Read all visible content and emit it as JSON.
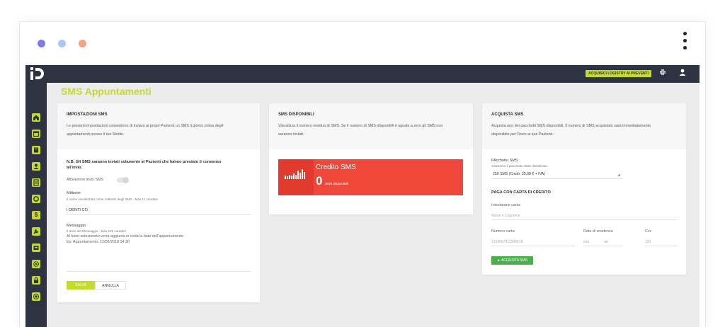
{
  "window": {
    "dot_colors": [
      "#7b7bea",
      "#a8c8f5",
      "#f2a585"
    ]
  },
  "colors": {
    "accent": "#c6da2a",
    "dark": "#2d3340",
    "danger": "#ef473a",
    "success": "#4cae4c"
  },
  "topbar": {
    "promo_label": "ACQUISICI LOGISTRY AI PREVENTI"
  },
  "sidebar": {
    "items": [
      "home-icon",
      "calendar-icon",
      "agenda-icon",
      "user-icon",
      "document-icon",
      "refresh-icon",
      "dollar-icon",
      "wrench-icon",
      "inbox-icon",
      "gear-icon",
      "lock-icon",
      "target-icon"
    ]
  },
  "page": {
    "title": "SMS Appuntamenti"
  },
  "settings": {
    "title": "IMPOSTAZIONI SMS",
    "desc1": "Le presenti impostazioni consentono di inviare ai propri Pazienti un SMS il giorno prima degli",
    "desc2": "appuntamenti presso il tuo Studio.",
    "note1": "N.B. Gli SMS saranno inviati solamente ai Pazienti che hanno prestato il consenso",
    "note2": "all'invio.",
    "toggle_label": "Attivazione invio SMS",
    "sender_label": "Mittente",
    "sender_hint": "Il nome visualizzato come mittente degli SMS - Max 11 caratteri",
    "sender_value": "I DENTI CO",
    "message_label": "Messaggio",
    "message_hint": "Il testo del Messaggio - Max 126 caratteri",
    "message_line1": "Al testo selezionato verrà aggiunta in coda la data dell'appuntamento",
    "message_line2": "Es: Appuntamento: 12/06/2018 14:30",
    "save_label": "SALVA",
    "cancel_label": "ANNULLA"
  },
  "available": {
    "title": "SMS DISPONIBILI",
    "desc1": "Visualizza il numero residuo di SMS. Se il numero di SMS disponibili è uguale a zero gli SMS non",
    "desc2": "saranno inviati.",
    "credit_title": "Credito SMS",
    "credit_value": "0",
    "credit_sub": "SMS disponibili"
  },
  "purchase": {
    "title": "ACQUISTA SMS",
    "desc1": "Acquista uno dei pacchetti SMS disponibili. Il numero di SMS acquistato sarà immediatamente",
    "desc2": "disponibile per l'invio ai tuoi Pazienti.",
    "package_label": "PAcchetto SMS",
    "package_hint": "Seleziona il pacchetto SMS desiderato",
    "package_value": "250 SMS (Costo: 25,00 € + IVA)",
    "card_section": "PAGA CON CARTA DI CREDITO",
    "holder_label": "Intestatario carta",
    "holder_placeholder": "Nome e Cognome",
    "number_label": "Numero carta",
    "number_placeholder": "1234567812345678",
    "expiry_label": "Data di scadenza",
    "expiry_mm": "mm",
    "expiry_aa": "aa",
    "cvv_label": "Cvv",
    "cvv_placeholder": "123",
    "buy_label": "ACQUISTA SMS"
  }
}
